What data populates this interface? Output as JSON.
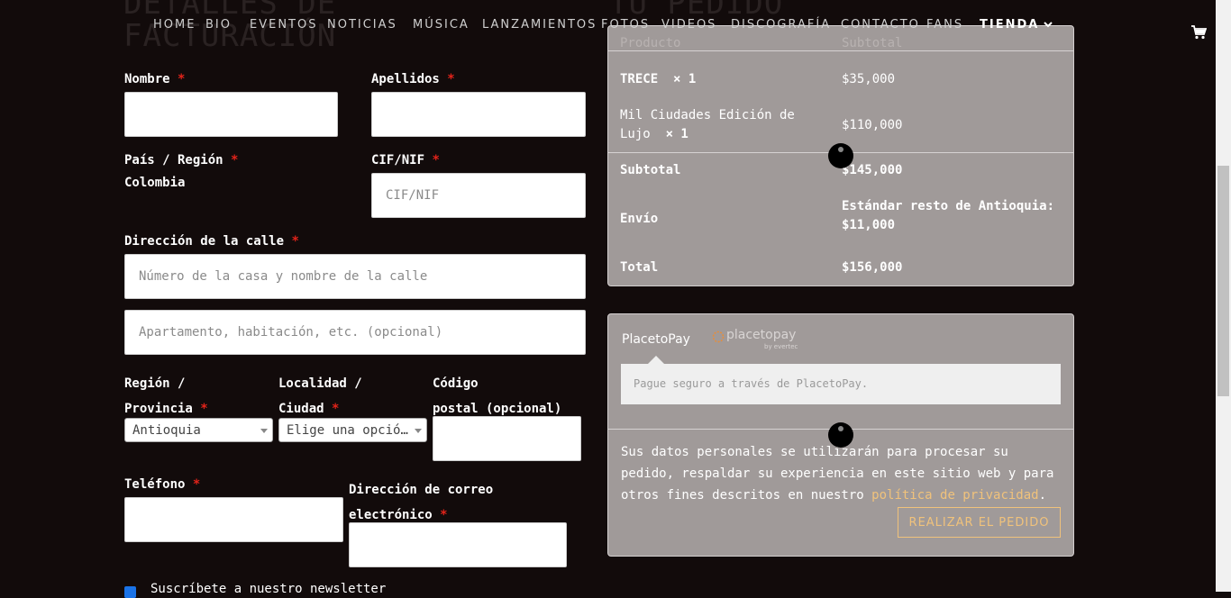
{
  "ghost_headings": {
    "billing_line1": "DETALLES DE",
    "billing_line2": "FACTURACIÓN",
    "order": "TU PEDIDO"
  },
  "nav": {
    "items": [
      "HOME",
      "BIO",
      "EVENTOS",
      "NOTICIAS",
      "MÚSICA",
      "LANZAMIENTOS",
      "FOTOS",
      "VIDEOS",
      "DISCOGRAFÍA",
      "CONTACTO",
      "FANS"
    ],
    "store": "TIENDA",
    "icons": {
      "store_chevron": "chevron-down-icon",
      "cart": "cart-icon"
    }
  },
  "form": {
    "required_mark": "*",
    "nombre": {
      "label": "Nombre",
      "value": ""
    },
    "apellidos": {
      "label": "Apellidos",
      "value": ""
    },
    "pais": {
      "label": "País / Región",
      "value": "Colombia"
    },
    "cif": {
      "label": "CIF/NIF",
      "placeholder": "CIF/NIF"
    },
    "direccion": {
      "label": "Dirección de la calle",
      "placeholder": "Número de la casa y nombre de la calle"
    },
    "direccion2": {
      "placeholder": "Apartamento, habitación, etc. (opcional)"
    },
    "region": {
      "label_line1": "Región /",
      "label_line2": "Provincia",
      "value": "Antioquia"
    },
    "localidad": {
      "label_line1": "Localidad /",
      "label_line2": "Ciudad",
      "value": "Elige una opción…"
    },
    "codigo": {
      "label_line1": "Código",
      "label_line2": "postal (opcional)",
      "value": ""
    },
    "telefono": {
      "label": "Teléfono",
      "value": ""
    },
    "email": {
      "label_line1": "Dirección de correo",
      "label_line2": "electrónico",
      "value": ""
    },
    "newsletter": {
      "label": "Suscríbete a nuestro newsletter",
      "checked": true
    }
  },
  "order": {
    "header": {
      "product": "Producto",
      "subtotal": "Subtotal"
    },
    "items": [
      {
        "name": "TRECE",
        "qty": "× 1",
        "price": "$35,000"
      },
      {
        "name_line1": "Mil Ciudades Edición de",
        "name_line2": "Lujo",
        "qty": "× 1",
        "price": "$110,000"
      }
    ],
    "subtotal": {
      "label": "Subtotal",
      "value": "$145,000"
    },
    "envio": {
      "label": "Envío",
      "value_line1": "Estándar resto de Antioquia:",
      "value_line2": "$11,000"
    },
    "total": {
      "label": "Total",
      "value": "$156,000"
    }
  },
  "payment": {
    "method": "PlacetoPay",
    "logo_text": "placetopay",
    "logo_sub": "by evertec",
    "description": "Pague seguro a través de PlacetoPay.",
    "privacy_line1": "Sus datos personales se utilizarán para procesar su",
    "privacy_line2": "pedido, respaldar su experiencia en este sitio web y para",
    "privacy_line3": "otros fines descritos en nuestro ",
    "privacy_link": "política de privacidad",
    "privacy_end": ".",
    "button": "REALIZAR EL PEDIDO"
  },
  "colors": {
    "background": "#120b0b",
    "panel": "#a09a99",
    "accent": "#f0c27b",
    "required": "#e2231a"
  }
}
